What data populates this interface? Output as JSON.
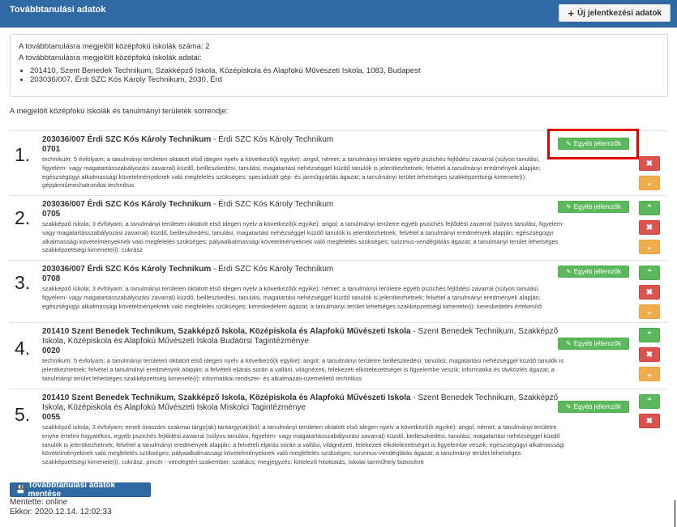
{
  "header": {
    "title": "Továbbtanulási adatok",
    "new_application_label": "Új jelentkezési adatok"
  },
  "info": {
    "count_line": "A továbbtanulásra megjelölt középfokú iskolák száma: 2",
    "data_line": "A továbbtanulásra megjelölt középfokú iskolák adatai:",
    "schools": [
      "201410, Szent Benedek Technikum, Szakképző Iskola, Középiskola és Alapfokú Művészeti Iskola, 1083, Budapest",
      "203036/007, Érdi SZC Kós Károly Technikum, 2030, Érd"
    ]
  },
  "section_title": "A megjelölt középfokú iskolák és tanulmányi területek sorrendje:",
  "features_label": "Egyéb jellemzők",
  "rows": [
    {
      "num": "1.",
      "title_bold": "203036/007 Érdi SZC Kós Károly Technikum",
      "title_rest": " - Érdi SZC Kós Károly Technikum",
      "code": "0701",
      "desc": "technikum; 5 évfolyam; a tanulmányi területen oktatott első idegen nyelv a következő(k egyike): angol, német; a tanulmányi területre egyéb pszichés fejlődési zavarral (súlyos tanulási, figyelem- vagy magatartásszabályozási zavarral) küzdő, beilleszkedési, tanulási, magatartási nehézséggel küzdő tanulók is jelentkezhetnek; felvétel a tanulmányi eredmények alapján; egészségügyi alkalmassági követelményeknek való megfelelés szükséges; specializált gép- és járműgyártás ágazat; a tanulmányi terület lehetséges szakképzettségi kimenete(i): gépjárműmechatronikai technikus"
    },
    {
      "num": "2.",
      "title_bold": "203036/007 Érdi SZC Kós Károly Technikum",
      "title_rest": " - Érdi SZC Kós Károly Technikum",
      "code": "0705",
      "desc": "szakképző iskola; 3 évfolyam; a tanulmányi területen oktatott első idegen nyelv a következő(k egyike): angol; a tanulmányi területre egyéb pszichés fejlődési zavarral (súlyos tanulási, figyelem- vagy magatartásszabályozási zavarral) küzdő, beilleszkedési, tanulási, magatartási nehézséggel küzdő tanulók is jelentkezhetnek; felvétel a tanulmányi eredmények alapján; egészségügyi alkalmassági követelményeknek való megfelelés szükséges; pályaalkalmassági követelményeknek való megfelelés szükséges; turizmus-vendéglátás ágazat; a tanulmányi terület lehetséges szakképzettségi kimenete(i): cukrász"
    },
    {
      "num": "3.",
      "title_bold": "203036/007 Érdi SZC Kós Károly Technikum",
      "title_rest": " - Érdi SZC Kós Károly Technikum",
      "code": "0708",
      "desc": "szakképző iskola; 3 évfolyam; a tanulmányi területen oktatott első idegen nyelv a következő(k egyike): német; a tanulmányi területre egyéb pszichés fejlődési zavarral (súlyos tanulási, figyelem- vagy magatartásszabályozási zavarral) küzdő, beilleszkedési, tanulási, magatartási nehézséggel küzdő tanulók is jelentkezhetnek; felvétel a tanulmányi eredmények alapján; egészségügyi alkalmassági követelményeknek való megfelelés szükséges; kereskedelem ágazat; a tanulmányi terület lehetséges szakképzettségi kimenete(i): kereskedelmi értékesítő"
    },
    {
      "num": "4.",
      "title_bold": "201410 Szent Benedek Technikum, Szakképző Iskola, Középiskola és Alapfokú Művészeti Iskola",
      "title_rest": " - Szent Benedek Technikum, Szakképző Iskola, Középiskola és Alapfokú Művészeti Iskola Budaörsi Tagintézménye",
      "code": "0020",
      "desc": "technikum; 5 évfolyam; a tanulmányi területen oktatott első idegen nyelv a következő(k egyike): angol; a tanulmányi területre beilleszkedési, tanulási, magatartási nehézséggel küzdő tanulók is jelentkezhetnek; felvétel a tanulmányi eredmények alapján; a felvételi eljárás során a vallási, világnézeti, felekezeti elkötelezettséget is figyelembe veszik; informatika és távközlés ágazat; a tanulmányi terület lehetséges szakképzettség kimenete(i): informatikai rendszer- és alkalmazás-üzemeltető technikus"
    },
    {
      "num": "5.",
      "title_bold": "201410 Szent Benedek Technikum, Szakképző Iskola, Középiskola és Alapfokú Művészeti Iskola",
      "title_rest": " - Szent Benedek Technikum, Szakképző Iskola, Középiskola és Alapfokú Művészeti Iskola Miskolci Tagintézménye",
      "code": "0055",
      "desc": "szakképző iskola; 3 évfolyam; emelt óraszám szakmai tárgy(ak) tantárgy(ak)ból; a tanulmányi területen oktatott első idegen nyelv a következő(k egyike): angol, német; a tanulmányi területre enyhe értelmi fogyatékos, egyéb pszichés fejlődési zavarral (súlyos tanulási, figyelem- vagy magatartásszabályozási zavarral) küzdő, beilleszkedési, tanulási, magatartási nehézséggel küzdő tanulók is jelentkezhetnek; felvétel a tanulmányi eredmények alapján; a felvételi eljárás során a vallási, világnézeti, felekezeti elkötelezettséget is figyelembe veszik; egészségügyi alkalmassági követelményeknek való megfelelés szükséges; pályaalkalmassági követelményeknek való megfelelés szükséges; turizmus-vendéglátás ágazat; a tanulmányi terület lehetséges szakképzettségi kimenete(i): cukrász, pincér - vendégtéri szakember, szakács; megjegyzés: kötelező hitoktatás, iskolai tanműhely biztosított"
    }
  ],
  "footer": {
    "save_label": "Továbbtanulási adatok mentése",
    "saved_status": "Mentette: online",
    "time_status": "Ekkor: 2020.12.14. 12:02:33"
  }
}
